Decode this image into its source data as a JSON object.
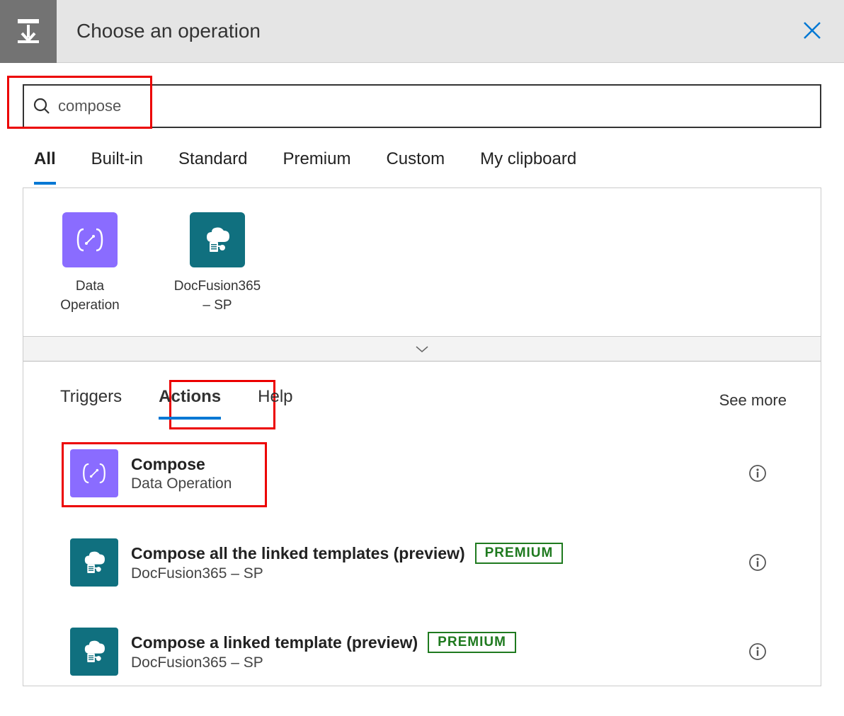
{
  "header": {
    "title": "Choose an operation"
  },
  "search": {
    "value": "compose"
  },
  "categoryTabs": [
    {
      "label": "All",
      "active": true
    },
    {
      "label": "Built-in",
      "active": false
    },
    {
      "label": "Standard",
      "active": false
    },
    {
      "label": "Premium",
      "active": false
    },
    {
      "label": "Custom",
      "active": false
    },
    {
      "label": "My clipboard",
      "active": false
    }
  ],
  "connectors": [
    {
      "label": "Data Operation",
      "color": "purple",
      "icon": "braces"
    },
    {
      "label": "DocFusion365 – SP",
      "color": "teal",
      "icon": "cloud-doc"
    }
  ],
  "actionTabs": {
    "triggers": "Triggers",
    "actions": "Actions",
    "help": "Help",
    "seeMore": "See more"
  },
  "actions": [
    {
      "title": "Compose",
      "subtitle": "Data Operation",
      "iconColor": "purple",
      "icon": "braces",
      "premium": false,
      "highlighted": true
    },
    {
      "title": "Compose all the linked templates (preview)",
      "subtitle": "DocFusion365 – SP",
      "iconColor": "teal",
      "icon": "cloud-doc",
      "premium": true,
      "highlighted": false
    },
    {
      "title": "Compose a linked template (preview)",
      "subtitle": "DocFusion365 – SP",
      "iconColor": "teal",
      "icon": "cloud-doc",
      "premium": true,
      "highlighted": false
    }
  ],
  "badges": {
    "premium": "PREMIUM"
  }
}
